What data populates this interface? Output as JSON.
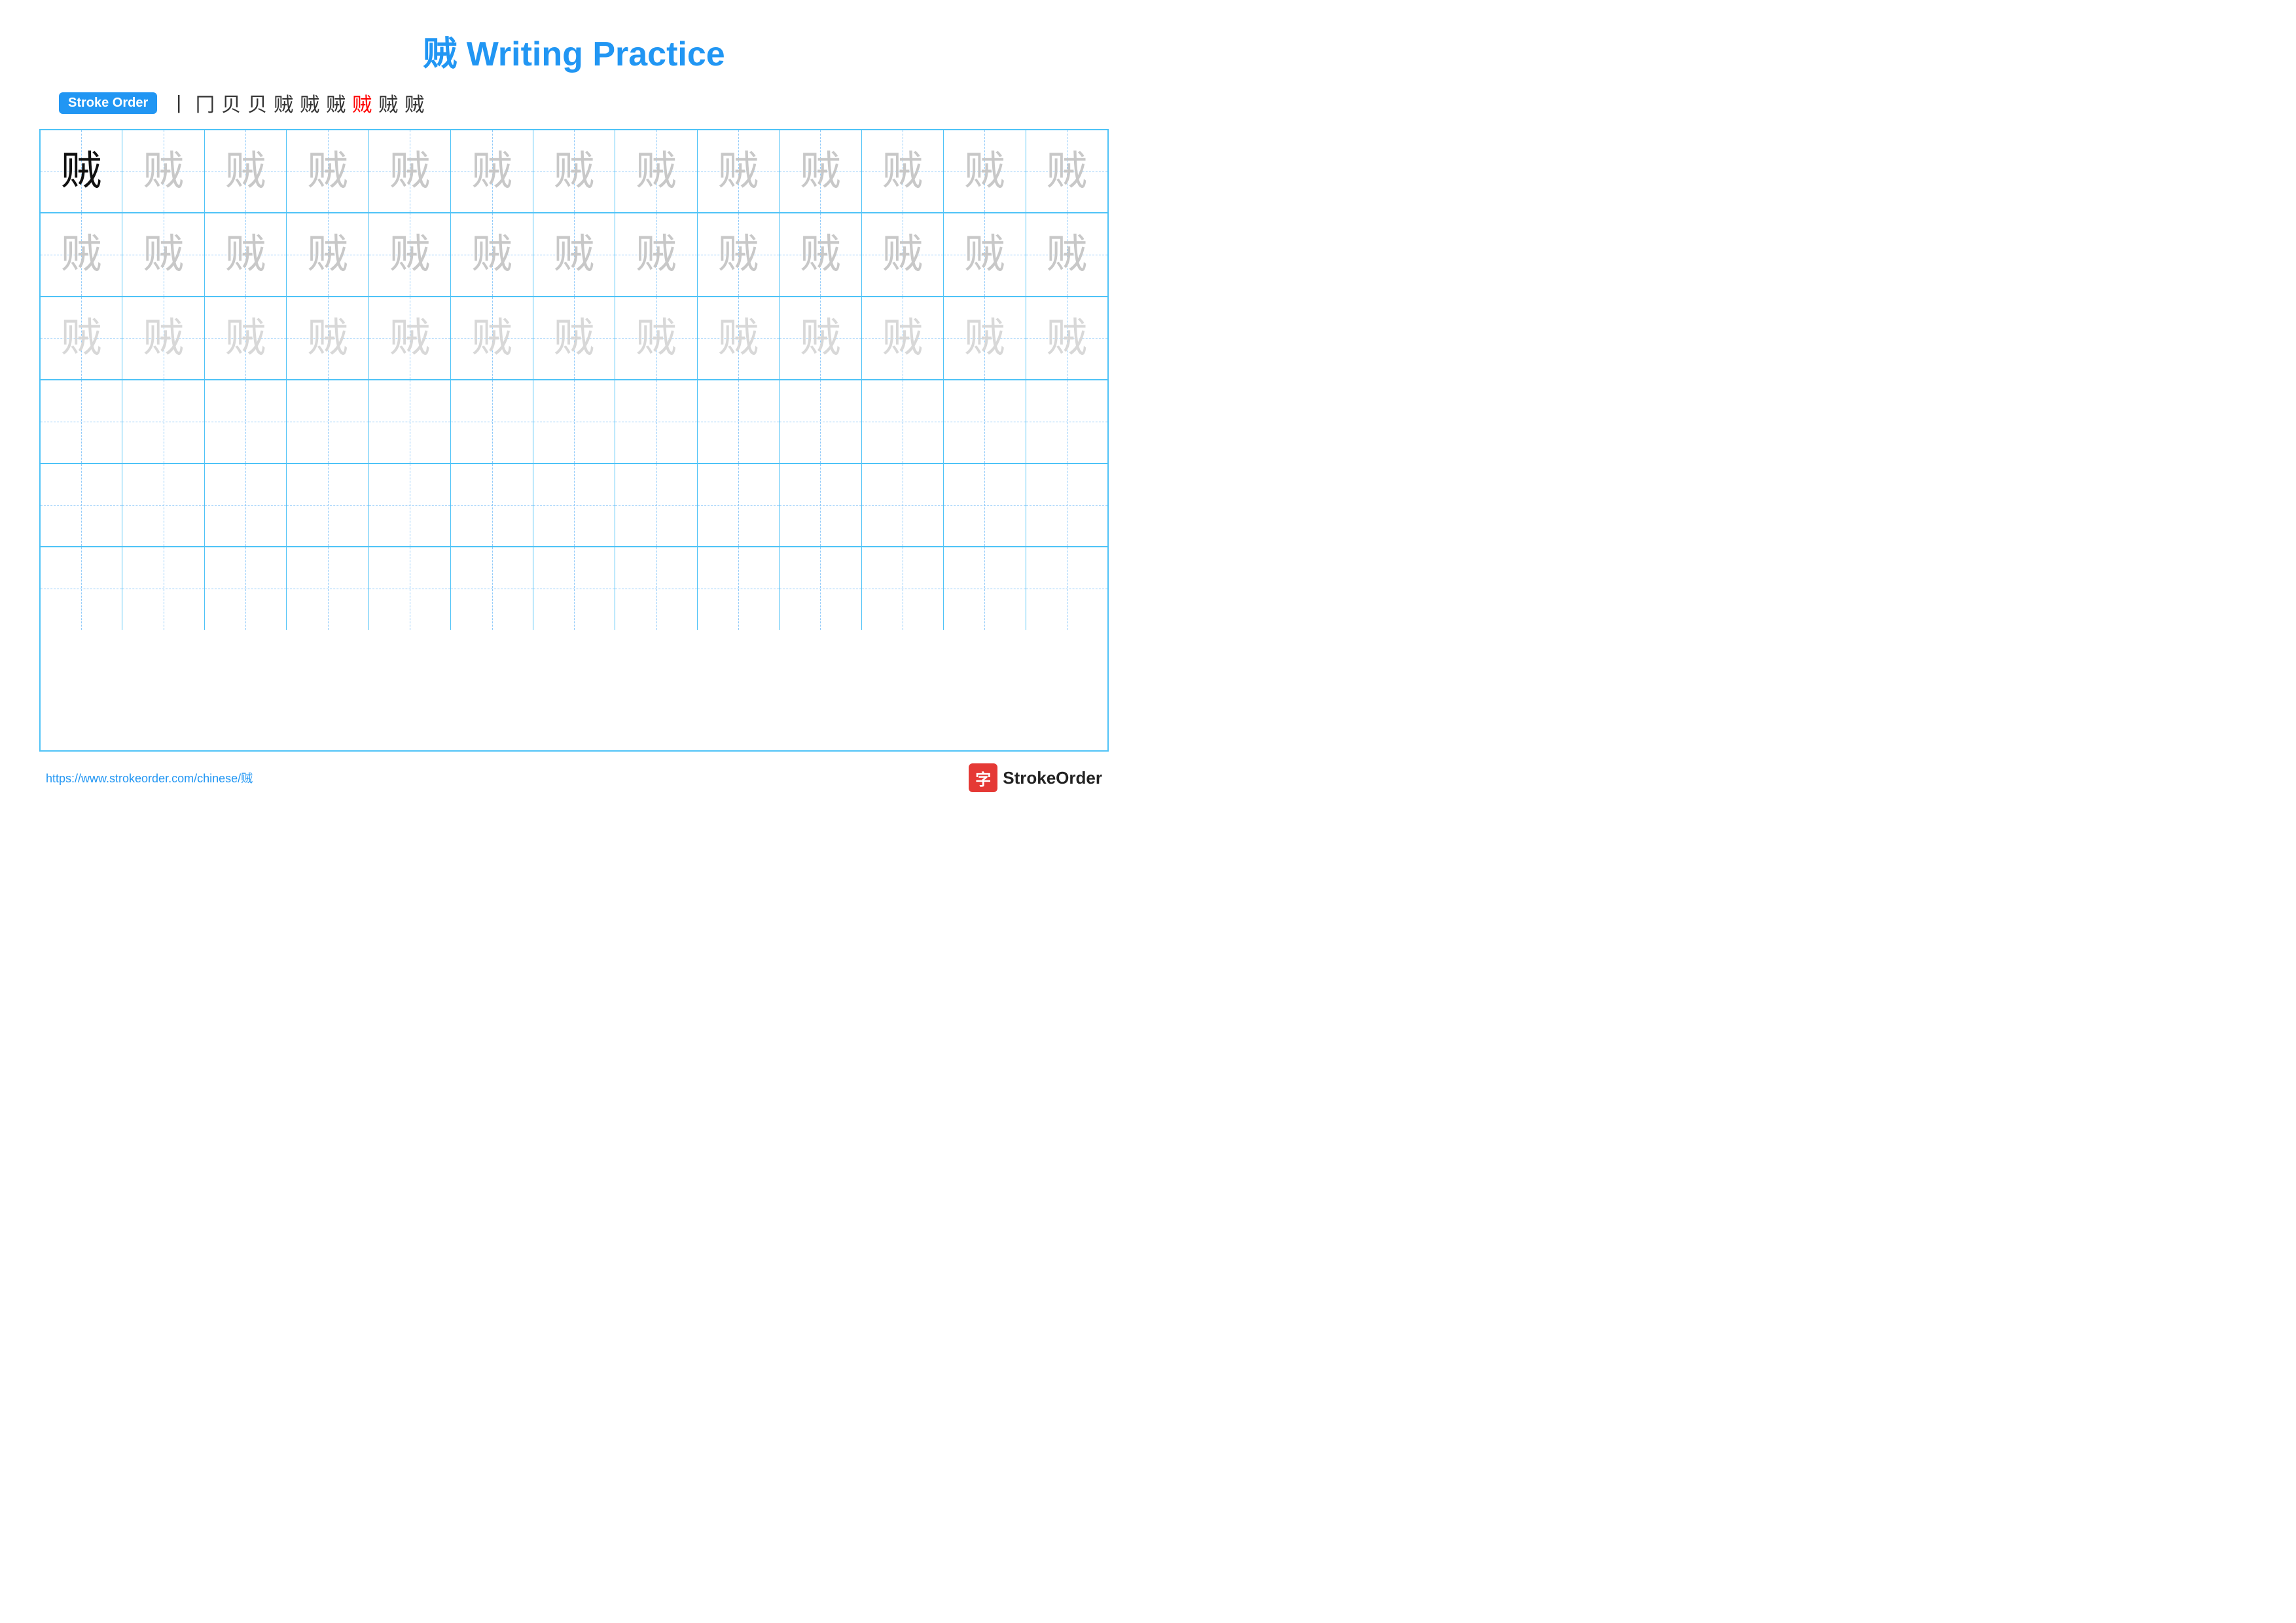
{
  "title": "贼 Writing Practice",
  "stroke_order": {
    "badge": "Stroke Order",
    "steps": [
      "丨",
      "冂",
      "冃",
      "贝",
      "贝⼀",
      "贼⼆",
      "贼三",
      "贼",
      "贼",
      "贼"
    ]
  },
  "character": "贼",
  "grid": {
    "rows": 6,
    "cols": 13
  },
  "footer": {
    "url": "https://www.strokeorder.com/chinese/贼",
    "logo_char": "字",
    "logo_text": "StrokeOrder"
  }
}
